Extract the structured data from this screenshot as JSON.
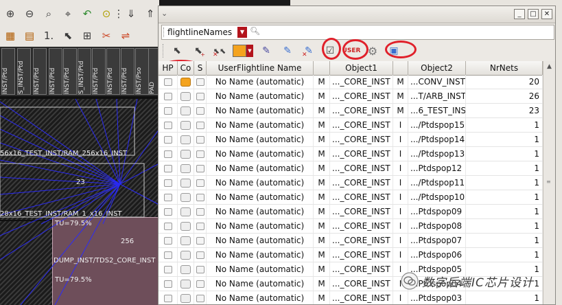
{
  "background_viewer": {
    "inst_columns": [
      "INST/Ptd",
      "S_INST/Ptd",
      "INST/Ptd",
      "INST/Ptd",
      "INST/Ptd",
      "S_INST/Ptd",
      "INST/Ptd",
      "INST/Ptd",
      "INST/Ptd",
      "INST/Pso",
      "PAD"
    ],
    "canvas_labels": {
      "label1": "56x16_TEST_INST/RAM_256x16_INST",
      "count1": "23",
      "label2": "28x16_TEST_INST/RAM_1_x16_INST",
      "util1": "TU=79.5%",
      "count2": "256",
      "label3": "DUMP_INST/TDS2_CORE_INST",
      "util2": "TU=79.5%"
    }
  },
  "dialog": {
    "title": "",
    "search": {
      "value": "flightlineNames"
    },
    "toolbar_icons": [
      "select-arrow-icon",
      "add-arrow-icon",
      "delete-arrows-icon",
      "color-swatch",
      "pencil-icon",
      "pencil-blue-icon",
      "pencil-delete-icon",
      "checkbox-arrow-icon",
      "user-icon",
      "gear-icon",
      "window-icon"
    ],
    "accent_color": "#f4a31e",
    "highlight_color": "#e0202a"
  },
  "table": {
    "headers": {
      "hp": "HP",
      "co": "Co",
      "s": "S",
      "name": "UserFlightline Name",
      "t1": "",
      "object1": "Object1",
      "t2": "",
      "object2": "Object2",
      "nrnets": "NrNets"
    },
    "rows": [
      {
        "name": "No Name (automatic)",
        "t1": "M",
        "object1": "..._CORE_INST",
        "t2": "M",
        "object2": "...CONV_INST",
        "nrnets": "20",
        "color": "orange"
      },
      {
        "name": "No Name (automatic)",
        "t1": "M",
        "object1": "..._CORE_INST",
        "t2": "M",
        "object2": "...T/ARB_INST",
        "nrnets": "26",
        "color": "grey"
      },
      {
        "name": "No Name (automatic)",
        "t1": "M",
        "object1": "..._CORE_INST",
        "t2": "M",
        "object2": "...6_TEST_INST",
        "nrnets": "23",
        "color": "grey"
      },
      {
        "name": "No Name (automatic)",
        "t1": "M",
        "object1": "..._CORE_INST",
        "t2": "I",
        "object2": ".../Ptdspop15",
        "nrnets": "1",
        "color": "grey"
      },
      {
        "name": "No Name (automatic)",
        "t1": "M",
        "object1": "..._CORE_INST",
        "t2": "I",
        "object2": ".../Ptdspop14",
        "nrnets": "1",
        "color": "grey"
      },
      {
        "name": "No Name (automatic)",
        "t1": "M",
        "object1": "..._CORE_INST",
        "t2": "I",
        "object2": ".../Ptdspop13",
        "nrnets": "1",
        "color": "grey"
      },
      {
        "name": "No Name (automatic)",
        "t1": "M",
        "object1": "..._CORE_INST",
        "t2": "I",
        "object2": "...Ptdspop12",
        "nrnets": "1",
        "color": "grey"
      },
      {
        "name": "No Name (automatic)",
        "t1": "M",
        "object1": "..._CORE_INST",
        "t2": "I",
        "object2": ".../Ptdspop11",
        "nrnets": "1",
        "color": "grey"
      },
      {
        "name": "No Name (automatic)",
        "t1": "M",
        "object1": "..._CORE_INST",
        "t2": "I",
        "object2": ".../Ptdspop10",
        "nrnets": "1",
        "color": "grey"
      },
      {
        "name": "No Name (automatic)",
        "t1": "M",
        "object1": "..._CORE_INST",
        "t2": "I",
        "object2": "...Ptdspop09",
        "nrnets": "1",
        "color": "grey"
      },
      {
        "name": "No Name (automatic)",
        "t1": "M",
        "object1": "..._CORE_INST",
        "t2": "I",
        "object2": "...Ptdspop08",
        "nrnets": "1",
        "color": "grey"
      },
      {
        "name": "No Name (automatic)",
        "t1": "M",
        "object1": "..._CORE_INST",
        "t2": "I",
        "object2": "...Ptdspop07",
        "nrnets": "1",
        "color": "grey"
      },
      {
        "name": "No Name (automatic)",
        "t1": "M",
        "object1": "..._CORE_INST",
        "t2": "I",
        "object2": "...Ptdspop06",
        "nrnets": "1",
        "color": "grey"
      },
      {
        "name": "No Name (automatic)",
        "t1": "M",
        "object1": "..._CORE_INST",
        "t2": "I",
        "object2": "...Ptdspop05",
        "nrnets": "1",
        "color": "grey"
      },
      {
        "name": "No Name (automatic)",
        "t1": "M",
        "object1": "..._CORE_INST",
        "t2": "I",
        "object2": "...Ptdspop04",
        "nrnets": "1",
        "color": "grey"
      },
      {
        "name": "No Name (automatic)",
        "t1": "M",
        "object1": "..._CORE_INST",
        "t2": "I",
        "object2": "...Ptdspop03",
        "nrnets": "1",
        "color": "grey"
      }
    ]
  },
  "watermark": {
    "text": "数字后端IC芯片设计"
  }
}
